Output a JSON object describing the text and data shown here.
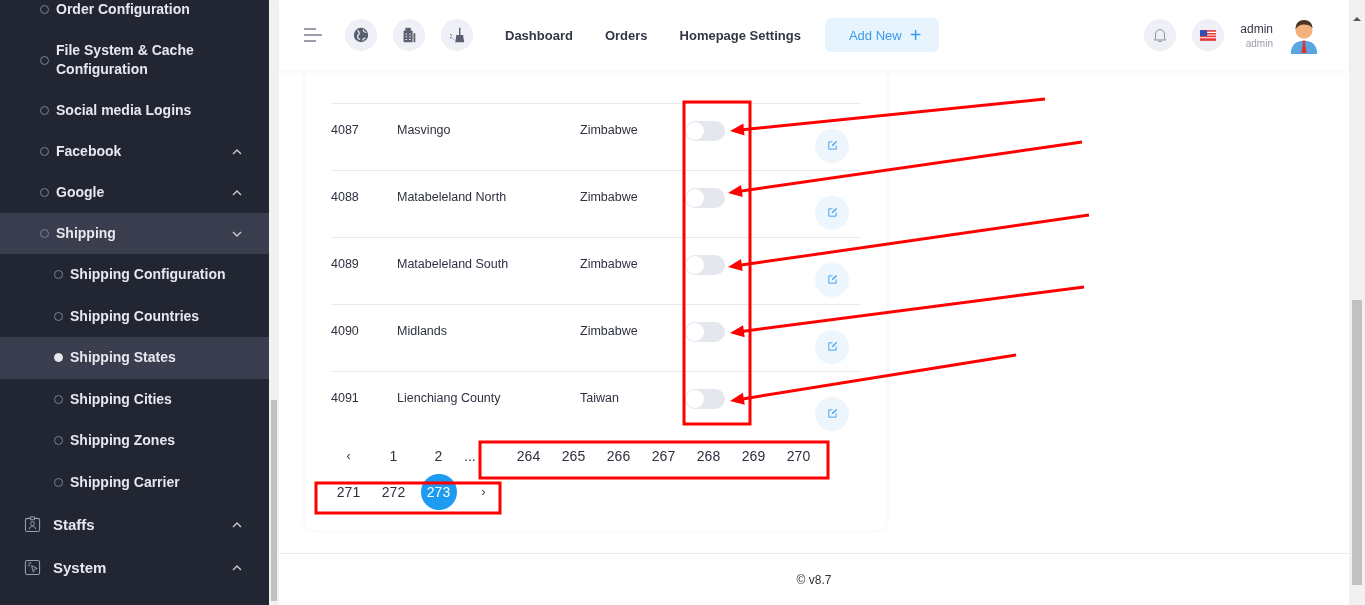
{
  "sidebar": {
    "items": [
      {
        "kind": "link",
        "label": "Order Configuration",
        "selected": false
      },
      {
        "kind": "link",
        "label": "File System & Cache Configuration",
        "selected": false
      },
      {
        "kind": "link",
        "label": "Social media Logins",
        "selected": false
      },
      {
        "kind": "group",
        "label": "Facebook",
        "selected": false,
        "expanded": false
      },
      {
        "kind": "group",
        "label": "Google",
        "selected": false,
        "expanded": false
      },
      {
        "kind": "group",
        "label": "Shipping",
        "selected": true,
        "expanded": true,
        "children": [
          {
            "label": "Shipping Configuration",
            "selected": false
          },
          {
            "label": "Shipping Countries",
            "selected": false
          },
          {
            "label": "Shipping States",
            "selected": true
          },
          {
            "label": "Shipping Cities",
            "selected": false
          },
          {
            "label": "Shipping Zones",
            "selected": false
          },
          {
            "label": "Shipping Carrier",
            "selected": false
          }
        ]
      },
      {
        "kind": "section",
        "label": "Staffs",
        "selected": false,
        "expanded": false
      },
      {
        "kind": "section",
        "label": "System",
        "selected": false,
        "expanded": false
      }
    ]
  },
  "header": {
    "nav": [
      "Dashboard",
      "Orders",
      "Homepage Settings"
    ],
    "add_button": "Add New",
    "add_icon": "+",
    "user": {
      "name": "admin",
      "role": "admin"
    }
  },
  "table": {
    "rows": [
      {
        "kind": "full",
        "id": "4087",
        "name": "Masvingo",
        "country": "Zimbabwe",
        "on": false
      },
      {
        "kind": "full",
        "id": "4088",
        "name": "Matabeleland North",
        "country": "Zimbabwe",
        "on": false
      },
      {
        "kind": "full",
        "id": "4089",
        "name": "Matabeleland South",
        "country": "Zimbabwe",
        "on": false
      },
      {
        "kind": "full",
        "id": "4090",
        "name": "Midlands",
        "country": "Zimbabwe",
        "on": false
      },
      {
        "kind": "full",
        "id": "4091",
        "name": "Lienchiang County",
        "country": "Taiwan",
        "on": false
      }
    ]
  },
  "pagination": {
    "prev": "‹",
    "next": "›",
    "pages": [
      {
        "label": "1",
        "selected": false
      },
      {
        "label": "2",
        "selected": false
      },
      {
        "label": "...",
        "selected": false
      },
      {
        "label": "264",
        "selected": false
      },
      {
        "label": "265",
        "selected": false
      },
      {
        "label": "266",
        "selected": false
      },
      {
        "label": "267",
        "selected": false
      },
      {
        "label": "268",
        "selected": false
      },
      {
        "label": "269",
        "selected": false
      },
      {
        "label": "270",
        "selected": false
      },
      {
        "label": "271",
        "selected": false
      },
      {
        "label": "272",
        "selected": false
      },
      {
        "label": "273",
        "selected": true
      }
    ]
  },
  "footer": {
    "version": "© v8.7"
  }
}
